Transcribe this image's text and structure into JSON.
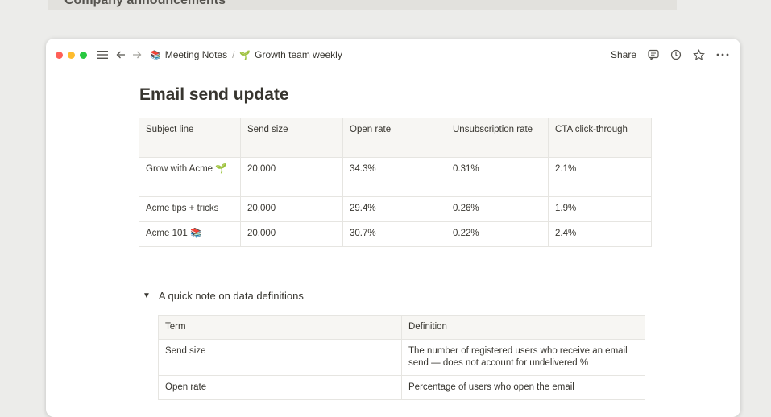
{
  "bg_title": "Company announcements",
  "window": {
    "colors": {
      "close": "#ff5f57",
      "minimize": "#febc2e",
      "maximize": "#28c840"
    },
    "breadcrumb": [
      {
        "icon": "books-emoji",
        "label": "Meeting Notes"
      },
      {
        "icon": "sprout-emoji",
        "label": "Growth team weekly"
      }
    ],
    "breadcrumb_sep": "/",
    "share_label": "Share"
  },
  "page": {
    "title": "Email send update",
    "table": {
      "headers": [
        "Subject line",
        "Send size",
        "Open rate",
        "Unsubscription rate",
        "CTA click-through"
      ],
      "rows": [
        [
          "Grow with Acme 🌱",
          "20,000",
          "34.3%",
          "0.31%",
          "2.1%"
        ],
        [
          "Acme tips + tricks",
          "20,000",
          "29.4%",
          "0.26%",
          "1.9%"
        ],
        [
          "Acme 101 📚",
          "20,000",
          "30.7%",
          "0.22%",
          "2.4%"
        ]
      ]
    },
    "toggle": {
      "label": "A quick note on data definitions",
      "table": {
        "headers": [
          "Term",
          "Definition"
        ],
        "rows": [
          [
            "Send size",
            "The number of registered users who receive an email send — does not account for undelivered %"
          ],
          [
            "Open rate",
            "Percentage of users who open the email"
          ]
        ]
      }
    }
  }
}
